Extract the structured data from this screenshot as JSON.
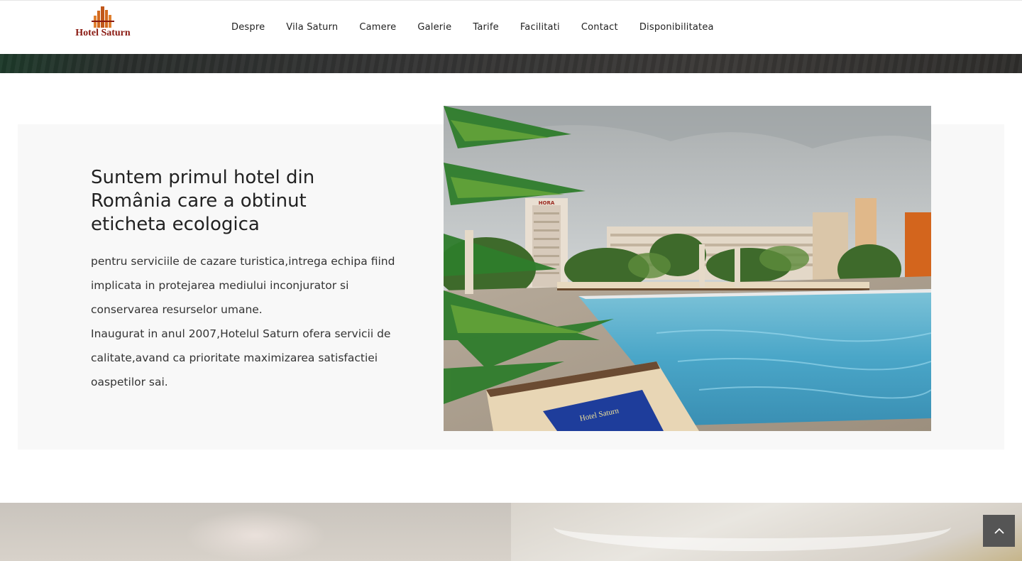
{
  "header": {
    "logo_text": "Hotel Saturn",
    "nav": [
      "Despre",
      "Vila Saturn",
      "Camere",
      "Galerie",
      "Tarife",
      "Facilitati",
      "Contact",
      "Disponibilitatea"
    ]
  },
  "about": {
    "title": "Suntem primul hotel din România care a obtinut eticheta ecologica",
    "paragraph1": "pentru serviciile de cazare turistica,intrega echipa fiind implicata in protejarea mediului inconjurator si conservarea resurselor umane.",
    "paragraph2": "Inaugurat in anul 2007,Hotelul Saturn ofera servicii de calitate,avand ca prioritate maximizarea satisfactiei oaspetilor sai.",
    "building_sign": "HORA",
    "towel_text": "Hotel Saturn"
  },
  "icons": {
    "scroll_top": "chevron-up-icon",
    "logo_stars": "★★★★★"
  },
  "colors": {
    "logo_red": "#8a1a12",
    "logo_orange": "#d2691e",
    "scroll_button": "#555555",
    "section_bg": "#f8f8f8"
  }
}
